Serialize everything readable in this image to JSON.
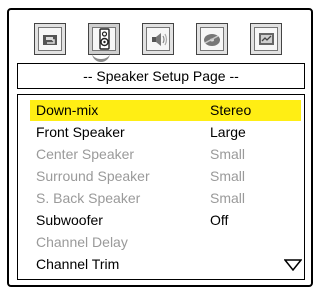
{
  "title": "-- Speaker Setup Page --",
  "tabs": [
    {
      "icon": "general-setup-icon"
    },
    {
      "icon": "speaker-icon"
    },
    {
      "icon": "audio-icon"
    },
    {
      "icon": "video-disc-icon"
    },
    {
      "icon": "preferences-icon"
    }
  ],
  "menu": {
    "items": [
      {
        "label": "Down-mix",
        "value": "Stereo",
        "state": "selected"
      },
      {
        "label": "Front Speaker",
        "value": "Large",
        "state": "enabled"
      },
      {
        "label": "Center Speaker",
        "value": "Small",
        "state": "disabled"
      },
      {
        "label": "Surround Speaker",
        "value": "Small",
        "state": "disabled"
      },
      {
        "label": "S. Back Speaker",
        "value": "Small",
        "state": "disabled"
      },
      {
        "label": "Subwoofer",
        "value": "Off",
        "state": "enabled"
      },
      {
        "label": "Channel Delay",
        "value": "",
        "state": "disabled"
      },
      {
        "label": "Channel Trim",
        "value": "",
        "state": "enabled"
      }
    ]
  },
  "colors": {
    "highlight": "#ffee14",
    "disabled_text": "#9a9a9a"
  }
}
